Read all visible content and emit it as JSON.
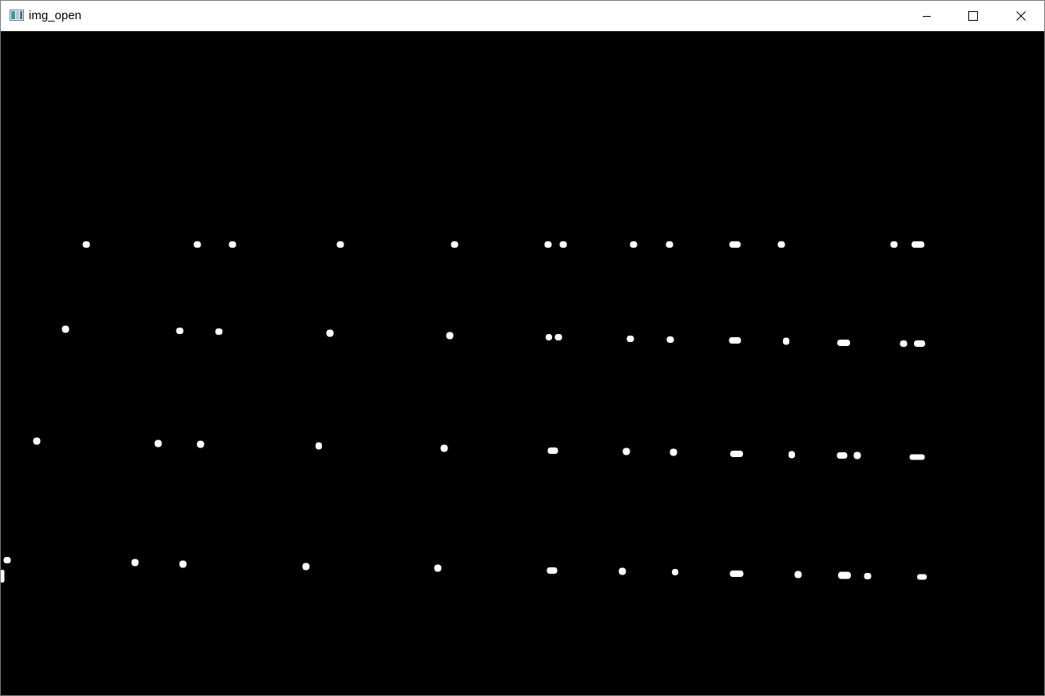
{
  "window": {
    "title": "img_open",
    "icon": "opencv-window-icon",
    "controls": {
      "minimize": "minimize-icon",
      "maximize": "maximize-icon",
      "close": "close-icon"
    }
  },
  "image": {
    "background": "#000000",
    "foreground": "#ffffff"
  }
}
